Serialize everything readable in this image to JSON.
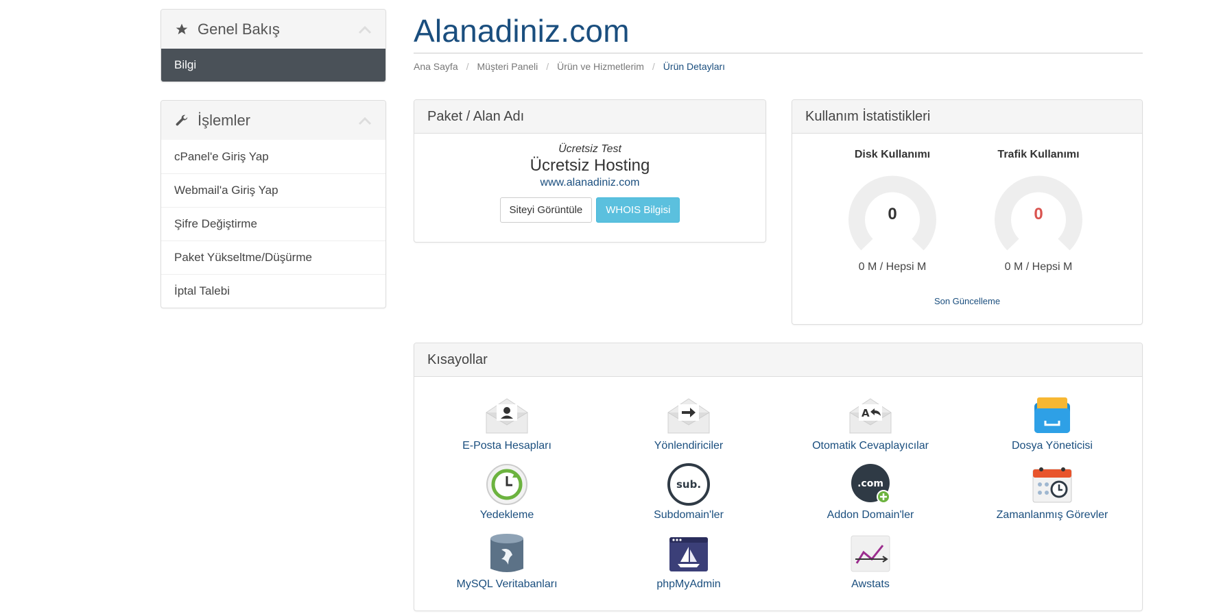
{
  "sidebar": {
    "overview": {
      "title": "Genel Bakış",
      "icon": "star-icon",
      "active_item": "Bilgi"
    },
    "actions": {
      "title": "İşlemler",
      "icon": "wrench-icon",
      "items": [
        {
          "label": "cPanel'e Giriş Yap"
        },
        {
          "label": "Webmail'a Giriş Yap"
        },
        {
          "label": "Şifre Değiştirme"
        },
        {
          "label": "Paket Yükseltme/Düşürme"
        },
        {
          "label": "İptal Talebi"
        }
      ]
    }
  },
  "header": {
    "title": "Alanadiniz.com",
    "breadcrumb": [
      "Ana Sayfa",
      "Müşteri Paneli",
      "Ürün ve Hizmetlerim",
      "Ürün Detayları"
    ]
  },
  "package_panel": {
    "title": "Paket / Alan Adı",
    "group": "Ücretsiz Test",
    "product": "Ücretsiz Hosting",
    "domain": "www.alanadiniz.com",
    "view_site_label": "Siteyi Görüntüle",
    "whois_label": "WHOIS Bilgisi"
  },
  "stats_panel": {
    "title": "Kullanım İstatistikleri",
    "disk": {
      "title": "Disk Kullanımı",
      "value": "0",
      "caption": "0 M / Hepsi M",
      "color": "#333333"
    },
    "traffic": {
      "title": "Trafik Kullanımı",
      "value": "0",
      "caption": "0 M / Hepsi M",
      "color": "#d9534f"
    },
    "last_update": "Son Güncelleme"
  },
  "shortcuts_panel": {
    "title": "Kısayollar",
    "items": [
      {
        "label": "E-Posta Hesapları",
        "icon": "email-accounts-icon"
      },
      {
        "label": "Yönlendiriciler",
        "icon": "forwarders-icon"
      },
      {
        "label": "Otomatik Cevaplayıcılar",
        "icon": "autoresponders-icon"
      },
      {
        "label": "Dosya Yöneticisi",
        "icon": "file-manager-icon"
      },
      {
        "label": "Yedekleme",
        "icon": "backup-icon"
      },
      {
        "label": "Subdomain'ler",
        "icon": "subdomains-icon"
      },
      {
        "label": "Addon Domain'ler",
        "icon": "addon-domains-icon"
      },
      {
        "label": "Zamanlanmış Görevler",
        "icon": "cron-jobs-icon"
      },
      {
        "label": "MySQL Veritabanları",
        "icon": "mysql-icon"
      },
      {
        "label": "phpMyAdmin",
        "icon": "phpmyadmin-icon"
      },
      {
        "label": "Awstats",
        "icon": "awstats-icon"
      }
    ]
  },
  "colors": {
    "brand_blue": "#1a4e7e",
    "active_nav": "#4a5158",
    "info_button": "#5bc0de",
    "traffic_value": "#d9534f"
  }
}
